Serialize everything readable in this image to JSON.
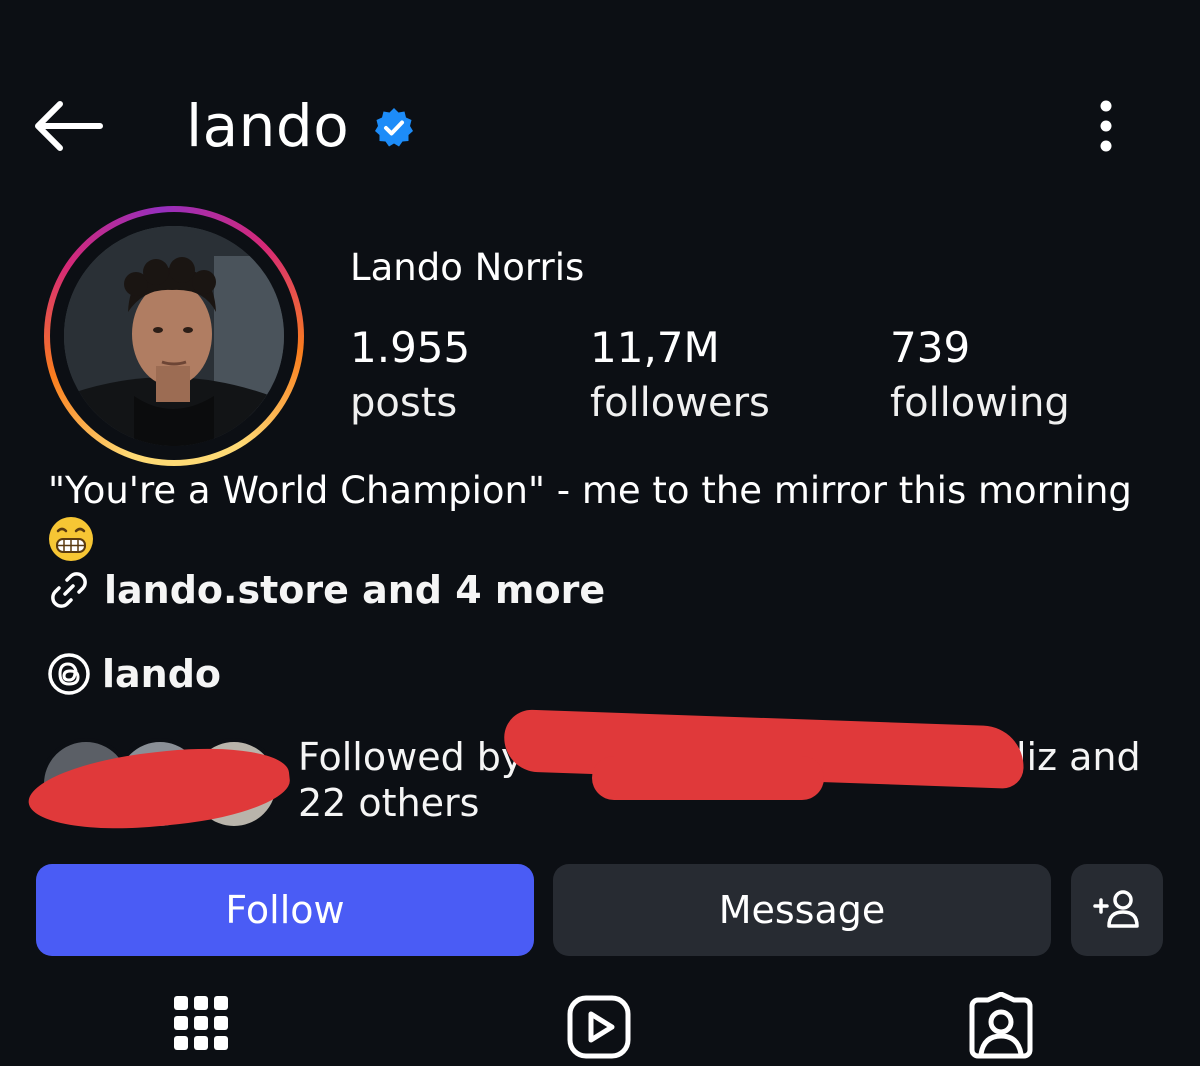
{
  "header": {
    "username": "lando",
    "back_icon": "arrow-left-icon",
    "verified_icon": "verified-badge-icon",
    "more_icon": "more-vertical-icon"
  },
  "profile": {
    "full_name": "Lando Norris",
    "stats": {
      "posts": {
        "value": "1.955",
        "label": "posts"
      },
      "followers": {
        "value": "11,7M",
        "label": "followers"
      },
      "following": {
        "value": "739",
        "label": "following"
      }
    },
    "bio": "\"You're a World Champion\" - me to the mirror this morning",
    "bio_emoji": "grinning-face-emoji",
    "link": "lando.store and 4 more",
    "threads": "lando"
  },
  "followed_by": {
    "line1_start": "Followed by eva",
    "line1_end": "liz and",
    "line2": "22 others"
  },
  "actions": {
    "follow": "Follow",
    "message": "Message",
    "suggest_icon": "add-person-icon"
  },
  "tabs": {
    "grid_icon": "grid-icon",
    "reels_icon": "reels-icon",
    "tagged_icon": "tagged-icon"
  },
  "colors": {
    "background": "#0c0f14",
    "follow_button": "#4a5cf5",
    "secondary_button": "#272b32",
    "verified": "#1d8cf8",
    "redaction": "#e0393a"
  }
}
